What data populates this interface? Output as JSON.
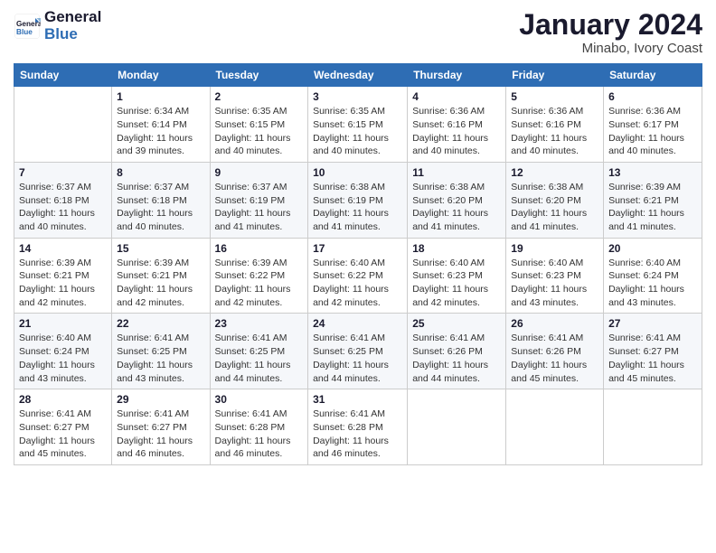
{
  "logo": {
    "text_general": "General",
    "text_blue": "Blue"
  },
  "title": "January 2024",
  "subtitle": "Minabo, Ivory Coast",
  "days_of_week": [
    "Sunday",
    "Monday",
    "Tuesday",
    "Wednesday",
    "Thursday",
    "Friday",
    "Saturday"
  ],
  "weeks": [
    [
      {
        "day": "",
        "info": ""
      },
      {
        "day": "1",
        "info": "Sunrise: 6:34 AM\nSunset: 6:14 PM\nDaylight: 11 hours\nand 39 minutes."
      },
      {
        "day": "2",
        "info": "Sunrise: 6:35 AM\nSunset: 6:15 PM\nDaylight: 11 hours\nand 40 minutes."
      },
      {
        "day": "3",
        "info": "Sunrise: 6:35 AM\nSunset: 6:15 PM\nDaylight: 11 hours\nand 40 minutes."
      },
      {
        "day": "4",
        "info": "Sunrise: 6:36 AM\nSunset: 6:16 PM\nDaylight: 11 hours\nand 40 minutes."
      },
      {
        "day": "5",
        "info": "Sunrise: 6:36 AM\nSunset: 6:16 PM\nDaylight: 11 hours\nand 40 minutes."
      },
      {
        "day": "6",
        "info": "Sunrise: 6:36 AM\nSunset: 6:17 PM\nDaylight: 11 hours\nand 40 minutes."
      }
    ],
    [
      {
        "day": "7",
        "info": "Sunrise: 6:37 AM\nSunset: 6:18 PM\nDaylight: 11 hours\nand 40 minutes."
      },
      {
        "day": "8",
        "info": "Sunrise: 6:37 AM\nSunset: 6:18 PM\nDaylight: 11 hours\nand 40 minutes."
      },
      {
        "day": "9",
        "info": "Sunrise: 6:37 AM\nSunset: 6:19 PM\nDaylight: 11 hours\nand 41 minutes."
      },
      {
        "day": "10",
        "info": "Sunrise: 6:38 AM\nSunset: 6:19 PM\nDaylight: 11 hours\nand 41 minutes."
      },
      {
        "day": "11",
        "info": "Sunrise: 6:38 AM\nSunset: 6:20 PM\nDaylight: 11 hours\nand 41 minutes."
      },
      {
        "day": "12",
        "info": "Sunrise: 6:38 AM\nSunset: 6:20 PM\nDaylight: 11 hours\nand 41 minutes."
      },
      {
        "day": "13",
        "info": "Sunrise: 6:39 AM\nSunset: 6:21 PM\nDaylight: 11 hours\nand 41 minutes."
      }
    ],
    [
      {
        "day": "14",
        "info": "Sunrise: 6:39 AM\nSunset: 6:21 PM\nDaylight: 11 hours\nand 42 minutes."
      },
      {
        "day": "15",
        "info": "Sunrise: 6:39 AM\nSunset: 6:21 PM\nDaylight: 11 hours\nand 42 minutes."
      },
      {
        "day": "16",
        "info": "Sunrise: 6:39 AM\nSunset: 6:22 PM\nDaylight: 11 hours\nand 42 minutes."
      },
      {
        "day": "17",
        "info": "Sunrise: 6:40 AM\nSunset: 6:22 PM\nDaylight: 11 hours\nand 42 minutes."
      },
      {
        "day": "18",
        "info": "Sunrise: 6:40 AM\nSunset: 6:23 PM\nDaylight: 11 hours\nand 42 minutes."
      },
      {
        "day": "19",
        "info": "Sunrise: 6:40 AM\nSunset: 6:23 PM\nDaylight: 11 hours\nand 43 minutes."
      },
      {
        "day": "20",
        "info": "Sunrise: 6:40 AM\nSunset: 6:24 PM\nDaylight: 11 hours\nand 43 minutes."
      }
    ],
    [
      {
        "day": "21",
        "info": "Sunrise: 6:40 AM\nSunset: 6:24 PM\nDaylight: 11 hours\nand 43 minutes."
      },
      {
        "day": "22",
        "info": "Sunrise: 6:41 AM\nSunset: 6:25 PM\nDaylight: 11 hours\nand 43 minutes."
      },
      {
        "day": "23",
        "info": "Sunrise: 6:41 AM\nSunset: 6:25 PM\nDaylight: 11 hours\nand 44 minutes."
      },
      {
        "day": "24",
        "info": "Sunrise: 6:41 AM\nSunset: 6:25 PM\nDaylight: 11 hours\nand 44 minutes."
      },
      {
        "day": "25",
        "info": "Sunrise: 6:41 AM\nSunset: 6:26 PM\nDaylight: 11 hours\nand 44 minutes."
      },
      {
        "day": "26",
        "info": "Sunrise: 6:41 AM\nSunset: 6:26 PM\nDaylight: 11 hours\nand 45 minutes."
      },
      {
        "day": "27",
        "info": "Sunrise: 6:41 AM\nSunset: 6:27 PM\nDaylight: 11 hours\nand 45 minutes."
      }
    ],
    [
      {
        "day": "28",
        "info": "Sunrise: 6:41 AM\nSunset: 6:27 PM\nDaylight: 11 hours\nand 45 minutes."
      },
      {
        "day": "29",
        "info": "Sunrise: 6:41 AM\nSunset: 6:27 PM\nDaylight: 11 hours\nand 46 minutes."
      },
      {
        "day": "30",
        "info": "Sunrise: 6:41 AM\nSunset: 6:28 PM\nDaylight: 11 hours\nand 46 minutes."
      },
      {
        "day": "31",
        "info": "Sunrise: 6:41 AM\nSunset: 6:28 PM\nDaylight: 11 hours\nand 46 minutes."
      },
      {
        "day": "",
        "info": ""
      },
      {
        "day": "",
        "info": ""
      },
      {
        "day": "",
        "info": ""
      }
    ]
  ]
}
